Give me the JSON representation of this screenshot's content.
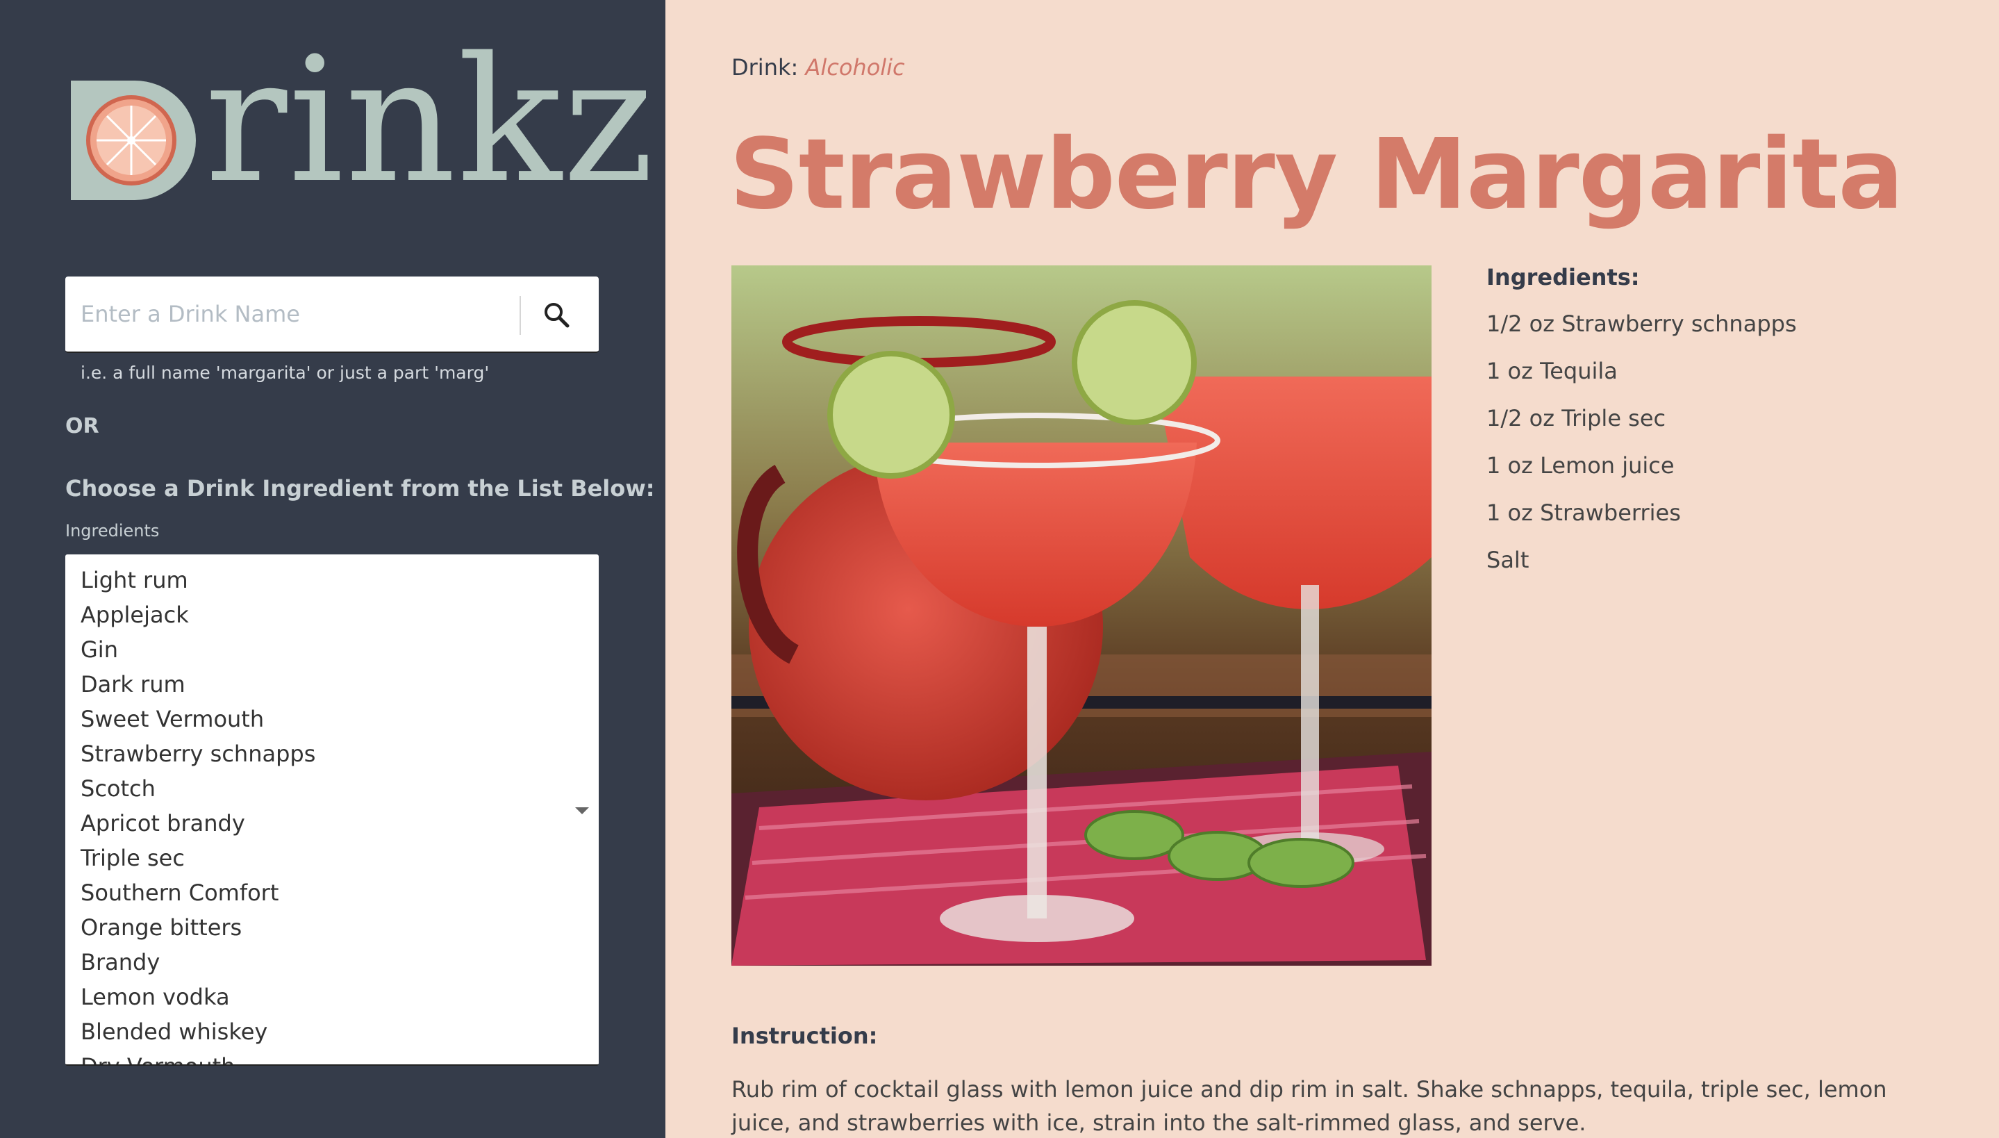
{
  "sidebar": {
    "logo": "Drinkz",
    "search": {
      "placeholder": "Enter a Drink Name",
      "value": ""
    },
    "hint": "i.e. a full name 'margarita' or just a part 'marg'",
    "or": "OR",
    "choose": "Choose a Drink Ingredient from the List Below:",
    "ingredients_label": "Ingredients",
    "ingredients": [
      "Light rum",
      "Applejack",
      "Gin",
      "Dark rum",
      "Sweet Vermouth",
      "Strawberry schnapps",
      "Scotch",
      "Apricot brandy",
      "Triple sec",
      "Southern Comfort",
      "Orange bitters",
      "Brandy",
      "Lemon vodka",
      "Blended whiskey",
      "Dry Vermouth"
    ]
  },
  "drink": {
    "type_label": "Drink:",
    "category": "Alcoholic",
    "name": "Strawberry Margarita",
    "ingredients_title": "Ingredients:",
    "ingredients": [
      "1/2 oz Strawberry schnapps",
      "1 oz Tequila",
      "1/2 oz Triple sec",
      "1 oz Lemon juice",
      "1 oz Strawberries",
      "Salt"
    ],
    "instruction_title": "Instruction:",
    "instruction": "Rub rim of cocktail glass with lemon juice and dip rim in salt. Shake schnapps, tequila, triple sec, lemon juice, and strawberries with ice, strain into the salt-rimmed glass, and serve."
  },
  "colors": {
    "sidebar_bg": "#353c4a",
    "main_bg": "#f5dccd",
    "accent": "#d47b69",
    "logo": "#b4c6bf"
  },
  "icons": {
    "search": "search-icon",
    "dropdown": "chevron-down-icon",
    "logo_mark": "orange-slice-icon"
  }
}
